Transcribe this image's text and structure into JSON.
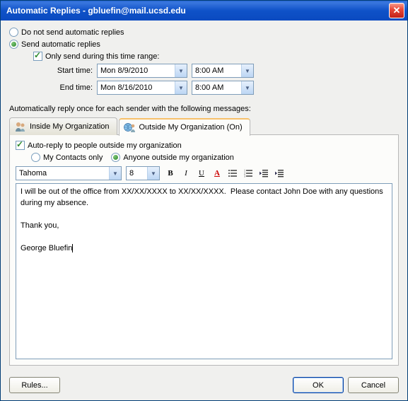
{
  "titlebar": {
    "title": "Automatic Replies - gbluefin@mail.ucsd.edu"
  },
  "main": {
    "opt_dont_send": "Do not send automatic replies",
    "opt_send": "Send automatic replies",
    "chk_range": "Only send during this time range:",
    "start_label": "Start time:",
    "end_label": "End time:",
    "start_date": "Mon 8/9/2010",
    "start_time": "8:00 AM",
    "end_date": "Mon 8/16/2010",
    "end_time": "8:00 AM",
    "autoreply_once": "Automatically reply once for each sender with the following messages:"
  },
  "tabs": {
    "inside": "Inside My Organization",
    "outside": "Outside My Organization (On)"
  },
  "panel": {
    "chk_outside": "Auto-reply to people outside my organization",
    "contacts_only": "My Contacts only",
    "anyone": "Anyone outside my organization",
    "font": "Tahoma",
    "size": "8",
    "message": "I will be out of the office from XX/XX/XXXX to XX/XX/XXXX.  Please contact John Doe with any questions during my absence.\n\nThank you,\n\nGeorge Bluefin"
  },
  "buttons": {
    "rules": "Rules...",
    "ok": "OK",
    "cancel": "Cancel"
  }
}
